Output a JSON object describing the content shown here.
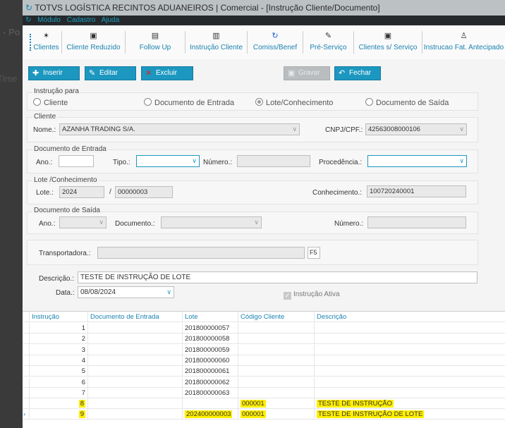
{
  "background": {
    "text1": "- Po",
    "text2": "Time"
  },
  "window": {
    "title": "TOTVS LOGÍSTICA RECINTOS ADUANEIROS | Comercial - [Instrução Cliente/Documento]"
  },
  "menu": [
    "Módulo",
    "Cadastro",
    "Ajuda"
  ],
  "toolbar": [
    "Clientes",
    "Cliente Reduzido",
    "Follow Up",
    "Instrução Cliente",
    "Comiss/Benef",
    "Pré-Serviço",
    "Clientes s/ Serviço",
    "Instrucao Fat. Antecipado"
  ],
  "actions": {
    "inserir": "Inserir",
    "editar": "Editar",
    "excluir": "Excluir",
    "gravar": "Gravar",
    "fechar": "Fechar"
  },
  "instrucao_para": {
    "title": "Instrução para",
    "options": [
      "Cliente",
      "Documento de Entrada",
      "Lote/Conhecimento",
      "Documento de Saída"
    ],
    "selected": "Lote/Conhecimento"
  },
  "cliente": {
    "title": "Cliente",
    "nome_label": "Nome.:",
    "nome": "AZANHA TRADING S/A.",
    "cnpj_label": "CNPJ/CPF.:",
    "cnpj": "42563008000106"
  },
  "doc_entrada": {
    "title": "Documento de Entrada",
    "ano_label": "Ano.:",
    "ano": "",
    "tipo_label": "Tipo.:",
    "tipo": "",
    "numero_label": "Número.:",
    "numero": "",
    "procedencia_label": "Procedência.:",
    "procedencia": ""
  },
  "lote": {
    "title": "Lote /Conhecimento",
    "lote_label": "Lote.:",
    "ano": "2024",
    "sep": "/",
    "numero": "00000003",
    "conhecimento_label": "Conhecimento.:",
    "conhecimento": "100720240001"
  },
  "doc_saida": {
    "title": "Documento de Saída",
    "ano_label": "Ano.:",
    "documento_label": "Documento.:",
    "numero_label": "Número.:"
  },
  "transportadora": {
    "label": "Transportadora.:",
    "value": "",
    "f5": "F5"
  },
  "descricao": {
    "label": "Descrição.:",
    "value": "TESTE DE INSTRUÇÃO DE LOTE"
  },
  "data": {
    "label": "Data.:",
    "value": "08/08/2024"
  },
  "ativa": {
    "label": "Instrução Ativa",
    "checked": true
  },
  "grid": {
    "columns": [
      "Instrução",
      "Documento de Entrada",
      "Lote",
      "Código Cliente",
      "Descrição"
    ],
    "rows": [
      [
        "1",
        "",
        "201800000057",
        "",
        ""
      ],
      [
        "2",
        "",
        "201800000058",
        "",
        ""
      ],
      [
        "3",
        "",
        "201800000059",
        "",
        ""
      ],
      [
        "4",
        "",
        "201800000060",
        "",
        ""
      ],
      [
        "5",
        "",
        "201800000061",
        "",
        ""
      ],
      [
        "6",
        "",
        "201800000062",
        "",
        ""
      ],
      [
        "7",
        "",
        "201800000063",
        "",
        ""
      ],
      [
        "8",
        "",
        "",
        "000001",
        "TESTE DE INSTRUÇÃO"
      ],
      [
        "9",
        "",
        "202400000003",
        "000001",
        "TESTE DE INSTRUÇÃO DE LOTE"
      ]
    ],
    "current_row": "9",
    "highlight_color": "#ffee00"
  }
}
